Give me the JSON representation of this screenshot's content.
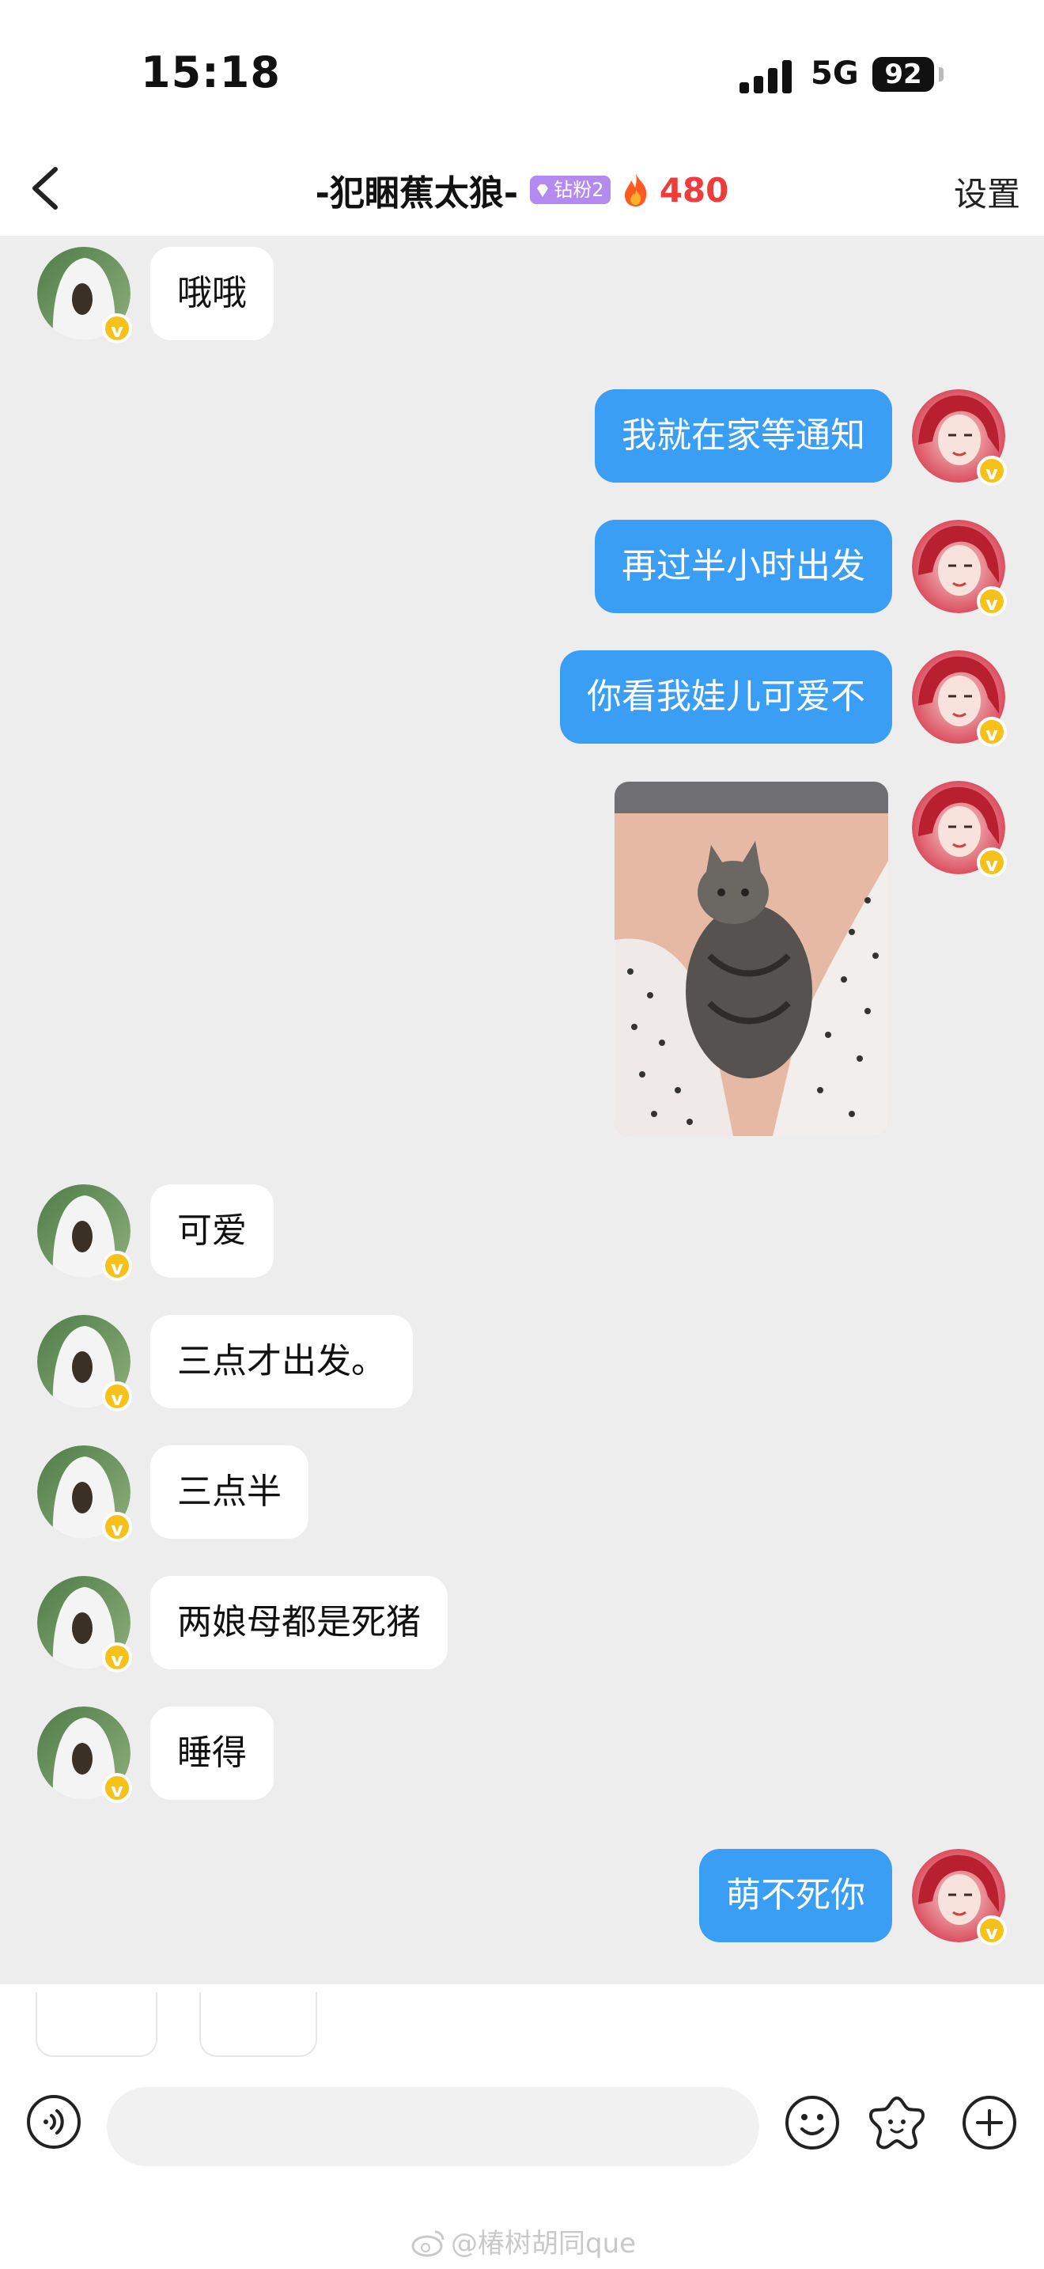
{
  "status_bar": {
    "time": "15:18",
    "network": "5G",
    "battery": "92"
  },
  "header": {
    "title": "-犯睏蕉太狼-",
    "fan_badge": "钻粉2",
    "streak": "480",
    "settings_label": "设置"
  },
  "messages": [
    {
      "side": "left",
      "text": "哦哦"
    },
    {
      "side": "right",
      "text": "我就在家等通知"
    },
    {
      "side": "right",
      "text": "再过半小时出发"
    },
    {
      "side": "right",
      "text": "你看我娃儿可爱不"
    },
    {
      "side": "right",
      "type": "image",
      "content": "cat photo"
    },
    {
      "side": "left",
      "text": "可爱"
    },
    {
      "side": "left",
      "text": "三点才出发。"
    },
    {
      "side": "left",
      "text": "三点半"
    },
    {
      "side": "left",
      "text": "两娘母都是死猪"
    },
    {
      "side": "left",
      "text": "睡得"
    },
    {
      "side": "right",
      "text": "萌不死你"
    }
  ],
  "input": {
    "placeholder": ""
  },
  "badges": {
    "verified_mark": "v"
  },
  "watermark": "@椿树胡同que",
  "colors": {
    "accent_bubble": "#3b9ef5",
    "background": "#ededed",
    "streak": "#ee3b3b",
    "fan_badge": "#b38af0",
    "verified": "#f6c21a"
  }
}
